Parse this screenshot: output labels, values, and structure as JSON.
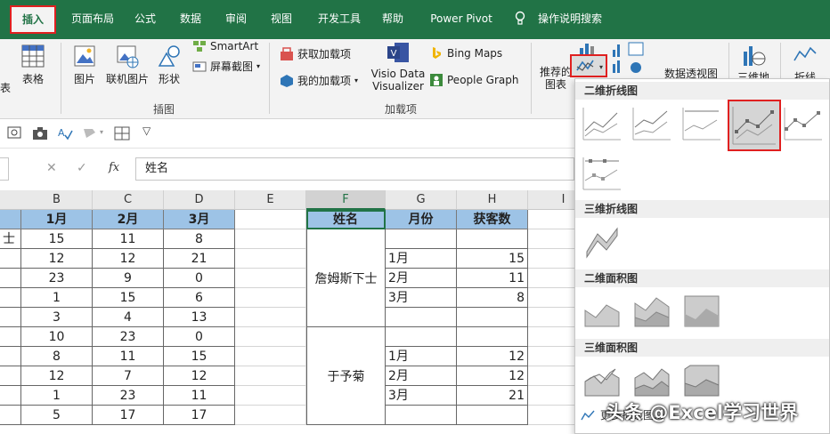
{
  "tabs": [
    {
      "label": "插入",
      "active": true
    },
    {
      "label": "页面布局"
    },
    {
      "label": "公式"
    },
    {
      "label": "数据"
    },
    {
      "label": "审阅"
    },
    {
      "label": "视图"
    },
    {
      "label": "开发工具"
    },
    {
      "label": "帮助"
    },
    {
      "label": "Power Pivot"
    },
    {
      "label": "操作说明搜索"
    }
  ],
  "ribbon": {
    "table_left": "表",
    "table": "表格",
    "picture": "图片",
    "online_picture": "联机图片",
    "shapes": "形状",
    "smartart": "SmartArt",
    "screenshot": "屏幕截图",
    "illustrations_group": "插图",
    "get_addins": "获取加载项",
    "my_addins": "我的加载项",
    "visio_1": "Visio Data",
    "visio_2": "Visualizer",
    "bing_maps": "Bing Maps",
    "people_graph": "People Graph",
    "addins_group": "加载项",
    "recommended_1": "推荐的",
    "recommended_2": "图表",
    "pivot_chart": "数据透视图",
    "map_3d": "三维地",
    "sparkline": "折线"
  },
  "formula": {
    "fx": "fx",
    "value": "姓名"
  },
  "sheet": {
    "columns": [
      "B",
      "C",
      "D",
      "E",
      "F",
      "G",
      "H",
      "I"
    ],
    "left_header": [
      "1月",
      "2月",
      "3月"
    ],
    "left_rows": [
      [
        "士",
        "15",
        "11",
        "8"
      ],
      [
        "",
        "12",
        "12",
        "21"
      ],
      [
        "",
        "23",
        "9",
        "0"
      ],
      [
        "",
        "1",
        "15",
        "6"
      ],
      [
        "",
        "3",
        "4",
        "13"
      ],
      [
        "",
        "10",
        "23",
        "0"
      ],
      [
        "",
        "8",
        "11",
        "15"
      ],
      [
        "",
        "12",
        "7",
        "12"
      ],
      [
        "",
        "1",
        "23",
        "11"
      ],
      [
        "",
        "5",
        "17",
        "17"
      ]
    ],
    "right_header": [
      "姓名",
      "月份",
      "获客数"
    ],
    "right_names": [
      "詹姆斯下士",
      "于予菊"
    ],
    "right_rows": [
      [
        "",
        ""
      ],
      [
        "1月",
        "15"
      ],
      [
        "2月",
        "11"
      ],
      [
        "3月",
        "8"
      ],
      [
        "",
        ""
      ],
      [
        "",
        ""
      ],
      [
        "1月",
        "12"
      ],
      [
        "2月",
        "12"
      ],
      [
        "3月",
        "21"
      ],
      [
        "",
        ""
      ]
    ]
  },
  "dropdown": {
    "sect_2d_line": "二维折线图",
    "sect_3d_line": "三维折线图",
    "sect_2d_area": "二维面积图",
    "sect_3d_area": "三维面积图",
    "more": "更多折线图..."
  },
  "watermark": "头条 @Excel学习世界",
  "colors": {
    "excel_green": "#217346",
    "header_blue": "#9dc3e6",
    "highlight_red": "#e02020"
  }
}
